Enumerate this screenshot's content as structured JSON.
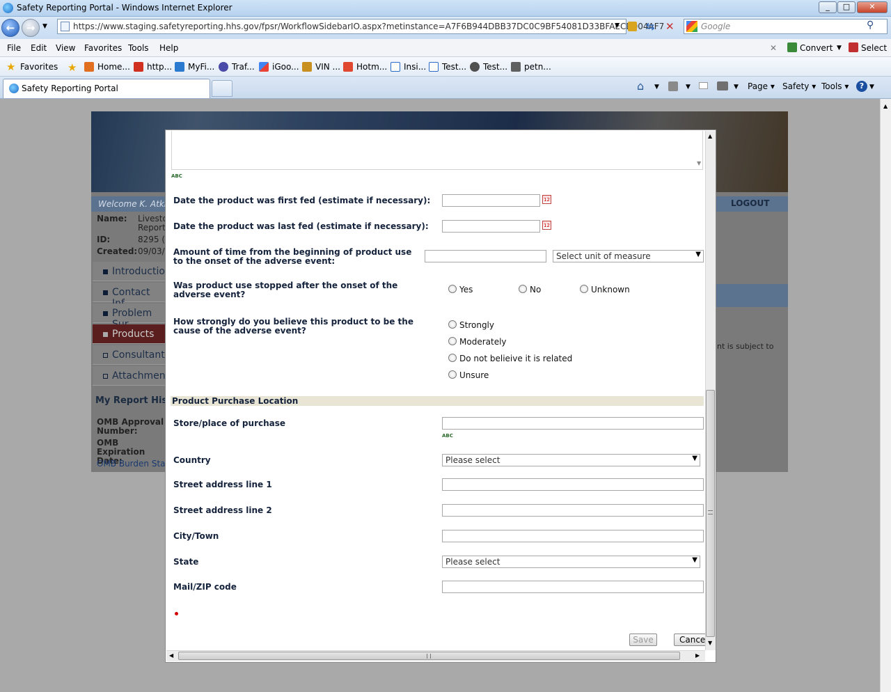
{
  "window": {
    "title": "Safety Reporting Portal - Windows Internet Explorer"
  },
  "address": {
    "url": "https://www.staging.safetyreporting.hhs.gov/fpsr/WorkflowSidebarIO.aspx?metinstance=A7F6B944DBB37DC0C9BF54081D33BFAECD004AF7",
    "search_placeholder": "Google"
  },
  "menu": {
    "items": [
      "File",
      "Edit",
      "View",
      "Favorites",
      "Tools",
      "Help"
    ],
    "convert": "Convert",
    "select": "Select"
  },
  "favorites": {
    "label": "Favorites",
    "items": [
      "Home...",
      "http...",
      "MyFi...",
      "Traf...",
      "iGoo...",
      "VIN ...",
      "Hotm...",
      "Insi...",
      "Test...",
      "Test...",
      "petn..."
    ]
  },
  "tab": {
    "title": "Safety Reporting Portal"
  },
  "toolbar": {
    "page": "Page",
    "safety": "Safety",
    "tools": "Tools"
  },
  "background": {
    "welcome": "Welcome K. Atki",
    "logout": "LOGOUT",
    "name_label": "Name:",
    "name_value_1": "Livesto",
    "name_value_2": "Report",
    "id_label": "ID:",
    "id_value": "8295 (",
    "created_label": "Created:",
    "created_value": "09/03/",
    "nav": [
      "Introduction",
      "Contact Inf",
      "Problem Sur",
      "Products",
      "Consultant",
      "Attachment"
    ],
    "history": "My Report His",
    "omb_approval": "OMB Approval Number:",
    "omb_expiration": "OMB Expiration Date:",
    "omb_burden": "OMB Burden Stat",
    "right_text": "nt is subject to"
  },
  "form": {
    "spell_label": "ABC",
    "first_fed_label": "Date the product was first fed (estimate if necessary):",
    "last_fed_label": "Date the product was last fed (estimate if necessary):",
    "amount_time_label": "Amount of time from the beginning of product use to the onset of the adverse event:",
    "unit_placeholder": "Select unit of measure",
    "stopped_label": "Was product use stopped after the onset of the adverse event?",
    "stopped_options": [
      "Yes",
      "No",
      "Unknown"
    ],
    "cause_label": "How strongly do you believe this product to be the cause of the adverse event?",
    "cause_options": [
      "Strongly",
      "Moderately",
      "Do not belieive it is related",
      "Unsure"
    ],
    "section_title": "Product Purchase Location",
    "store_label": "Store/place of purchase",
    "country_label": "Country",
    "country_value": "Please select",
    "street1_label": "Street address line 1",
    "street2_label": "Street address line 2",
    "city_label": "City/Town",
    "state_label": "State",
    "state_value": "Please select",
    "zip_label": "Mail/ZIP code",
    "save_label": "Save",
    "cancel_label": "Cance"
  }
}
